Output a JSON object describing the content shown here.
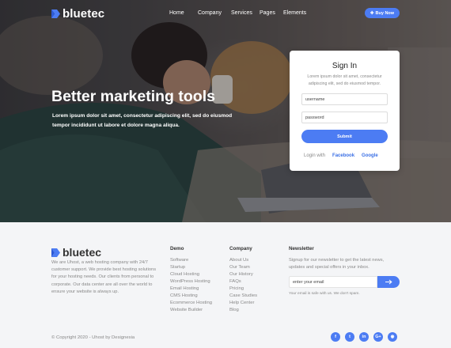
{
  "brand": {
    "name": "bluetec"
  },
  "nav": {
    "links": [
      "Home",
      "Company",
      "Services",
      "Pages",
      "Elements"
    ],
    "buy_label": "Buy Now"
  },
  "hero": {
    "title": "Better marketing tools",
    "subtitle": "Lorem ipsum dolor sit amet, consectetur adipiscing elit, sed do eiusmod tempor incididunt ut labore et dolore magna aliqua."
  },
  "signin": {
    "title": "Sign In",
    "description": "Lorem ipsum dolor sit amet, consectetur adipiscing elit, sed do eiusmod tempor.",
    "username_placeholder": "username",
    "password_placeholder": "password",
    "submit_label": "Submit",
    "login_with_label": "Login with",
    "facebook_label": "Facebook",
    "google_label": "Google"
  },
  "footer": {
    "about": "We are Uhost, a web hosting company with 24/7 customer support. We provide best hosting solutions for your hosting needs. Our clients from personal to corporate. Our data center are all over the world to ensure your website is always up.",
    "demo": {
      "heading": "Demo",
      "items": [
        "Software",
        "Startup",
        "Cloud Hosting",
        "WordPress Hosting",
        "Email Hosting",
        "CMS Hosting",
        "Ecommerce Hosting",
        "Website Builder"
      ]
    },
    "company": {
      "heading": "Company",
      "items": [
        "About Us",
        "Our Team",
        "Our History",
        "FAQs",
        "Pricing",
        "Case Studies",
        "Help Center",
        "Blog"
      ]
    },
    "newsletter": {
      "heading": "Newsletter",
      "text": "Signup for our newsletter to get the latest news, updates and special offers in your inbox.",
      "email_placeholder": "enter your email",
      "note": "Your email is safe with us. We don't spam."
    },
    "copyright": "© Copyright 2020 - Uhost by Designesia",
    "socials": [
      {
        "icon": "facebook-icon",
        "glyph": "f"
      },
      {
        "icon": "twitter-icon",
        "glyph": "t"
      },
      {
        "icon": "linkedin-icon",
        "glyph": "in"
      },
      {
        "icon": "google-plus-icon",
        "glyph": "G+"
      },
      {
        "icon": "rss-icon",
        "glyph": "◉"
      }
    ]
  },
  "colors": {
    "accent": "#4c7cf3",
    "link": "#3a6fe5"
  }
}
